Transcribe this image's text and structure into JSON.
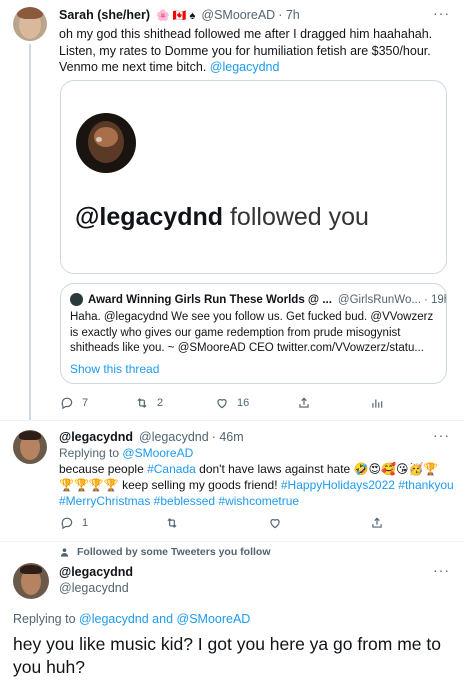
{
  "tweet1": {
    "author_name": "Sarah (she/her)",
    "author_emojis": "🌸 🇨🇦 ♠",
    "handle": "@SMooreAD",
    "time": "· 7h",
    "text": "oh my god this shithead followed me after I dragged him haahahah. Listen, my rates to Domme you for humiliation fetish are $350/hour. Venmo me next time bitch.",
    "mention": "@legacydnd",
    "image_card": {
      "followed_handle": "@legacydnd",
      "followed_text": "followed you"
    },
    "quote": {
      "author_name": "Award Winning Girls Run These Worlds @ ...",
      "handle": "@GirlsRunWo...",
      "time": "· 19h",
      "text": "Haha. @legacydnd We see you follow us. Get fucked bud. @VVowzerz is exactly who gives our game redemption from prude misogynist shitheads like you. ~ @SMooreAD CEO twitter.com/VVowzerz/statu...",
      "show_thread": "Show this thread"
    },
    "stats": {
      "replies": "7",
      "retweets": "2",
      "likes": "16"
    }
  },
  "tweet2": {
    "author_name": "@legacydnd",
    "handle": "@legacydnd",
    "time": "· 46m",
    "replying_label": "Replying to",
    "replying_to": "@SMooreAD",
    "text_start": "because people",
    "hashtag_canada": "#Canada",
    "text_mid": "don't have laws against hate",
    "emojis_line1": "🤣😍🥰😘🥳🏆",
    "emojis_line2": "🏆🏆🏆🏆",
    "text_end": "keep selling my goods friend!",
    "hashtags_line2": "#HappyHolidays2022 #thankyou",
    "hashtags_line3": "#MerryChristmas #beblessed #wishcometrue",
    "stats": {
      "replies": "1"
    }
  },
  "followed_by": "Followed by some Tweeters you follow",
  "tweet3": {
    "author_name": "@legacydnd",
    "handle": "@legacydnd",
    "replying_label": "Replying to",
    "replying_to": "@legacydnd and @SMooreAD",
    "text": "hey you like music kid? I got you here ya go from me to you huh?"
  },
  "colors": {
    "accent": "#1d9bf0",
    "muted": "#536471",
    "border": "#cfd9de",
    "thread_line": "#cfd9de"
  },
  "icons": [
    "reply-icon",
    "retweet-icon",
    "like-icon",
    "share-icon",
    "analytics-icon",
    "more-icon",
    "person-icon"
  ]
}
